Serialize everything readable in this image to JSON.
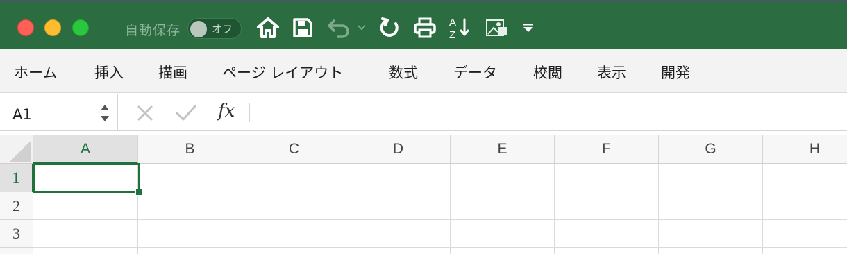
{
  "titlebar": {
    "autosave_label": "自動保存",
    "autosave_toggle_text": "オフ",
    "icons": [
      "home-icon",
      "save-icon",
      "undo-icon",
      "undo-dropdown-icon",
      "redo-icon",
      "print-icon",
      "sort-az-icon",
      "picture-icon",
      "customize-toolbar-icon"
    ],
    "sort_glyph_a": "A",
    "sort_glyph_z": "Z"
  },
  "ribbon": {
    "tabs": [
      {
        "label": "ホーム"
      },
      {
        "label": "挿入"
      },
      {
        "label": "描画"
      },
      {
        "label": "ページ レイアウト"
      },
      {
        "label": "数式"
      },
      {
        "label": "データ"
      },
      {
        "label": "校閲"
      },
      {
        "label": "表示"
      },
      {
        "label": "開発"
      }
    ]
  },
  "formula_bar": {
    "name_box": "A1",
    "fx_label": "fx",
    "formula_value": ""
  },
  "sheet": {
    "columns": [
      "A",
      "B",
      "C",
      "D",
      "E",
      "F",
      "G",
      "H"
    ],
    "rows": [
      "1",
      "2",
      "3"
    ],
    "selected_cell": "A1"
  },
  "colors": {
    "titlebar": "#2b6d40",
    "accent": "#21713f",
    "close": "#fe5f57",
    "minimize": "#febc2e",
    "maximize": "#29c840"
  }
}
